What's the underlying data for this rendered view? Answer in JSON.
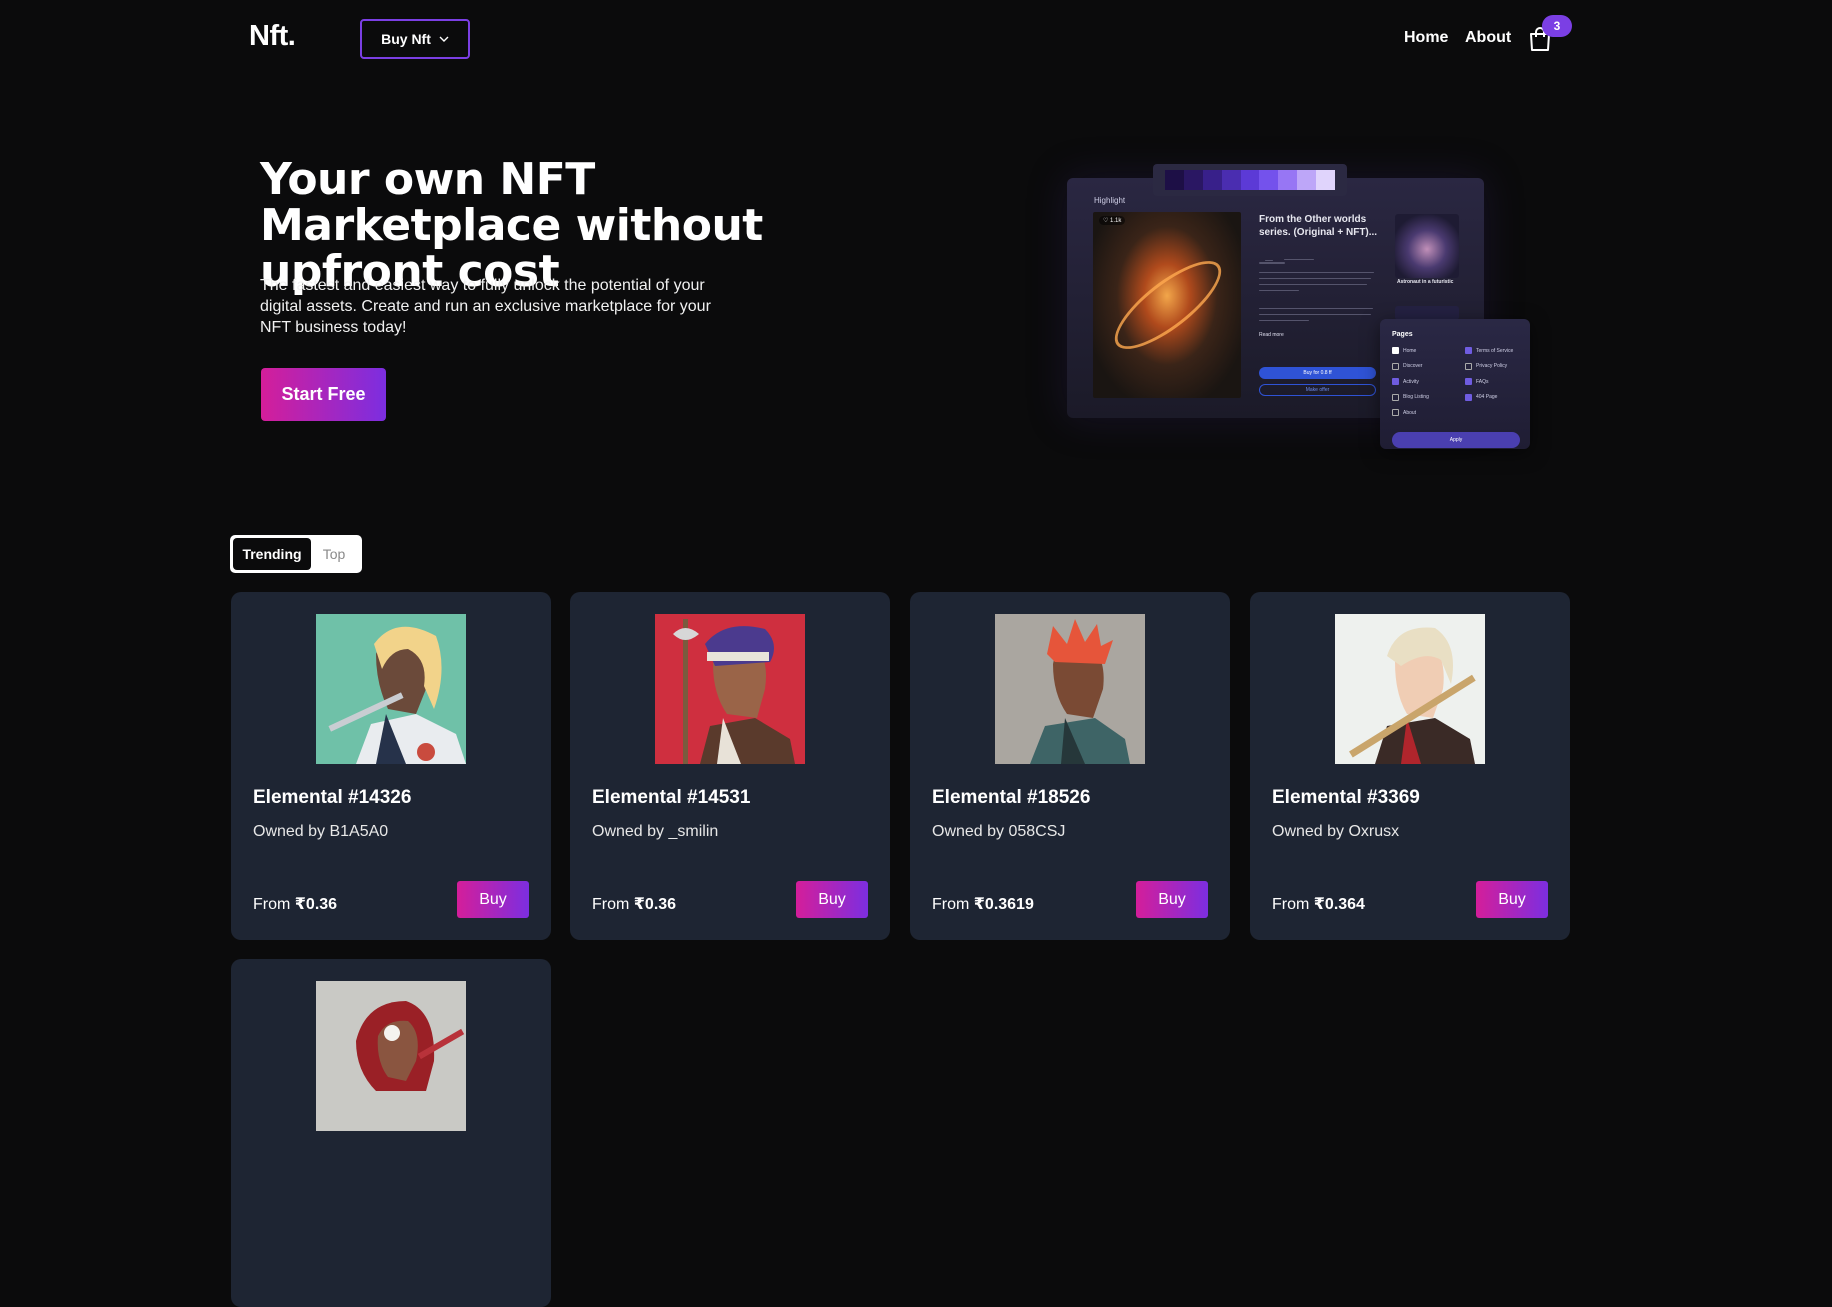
{
  "header": {
    "logo": "Nft.",
    "buy_nft_label": "Buy Nft",
    "nav": {
      "home": "Home",
      "about": "About"
    },
    "cart_count": "3",
    "accent": "#7b3fe4"
  },
  "hero": {
    "title": "Your own NFT Marketplace without upfront cost",
    "subtitle": "The fastest and easiest way to fully unlock the potential of your digital assets. Create and run an exclusive marketplace for your NFT business today!",
    "cta_label": "Start Free",
    "gradient": [
      "#d41e9a",
      "#7c2ee0"
    ]
  },
  "preview": {
    "palette": [
      "#1d0f46",
      "#2a1763",
      "#38208a",
      "#4a2db0",
      "#5c3ad6",
      "#7452ec",
      "#9776f4",
      "#bda6f8",
      "#e0d4fc"
    ],
    "highlight_label": "Highlight",
    "likes": "♡ 1.1k",
    "art_title": "From the Other worlds series. (Original + NFT)...",
    "read_more": "Read more",
    "buy_label": "Buy for 0.8 ff",
    "offer_label": "Make offer",
    "thumb_title": "Astronaut in a futuristic",
    "pages_title": "Pages",
    "pages_left": [
      {
        "label": "Home",
        "checked": "white"
      },
      {
        "label": "Discover",
        "checked": ""
      },
      {
        "label": "Activity",
        "checked": "on"
      },
      {
        "label": "Blog Listing",
        "checked": ""
      },
      {
        "label": "About",
        "checked": ""
      }
    ],
    "pages_right": [
      {
        "label": "Terms of Service",
        "checked": "on"
      },
      {
        "label": "Privacy Policy",
        "checked": ""
      },
      {
        "label": "FAQs",
        "checked": "on"
      },
      {
        "label": "404 Page",
        "checked": "on"
      }
    ],
    "apply_label": "Apply"
  },
  "tabs": {
    "trending": "Trending",
    "top": "Top"
  },
  "cards": [
    {
      "name": "Elemental #14326",
      "owner": "Owned by B1A5A0",
      "price_prefix": "From ",
      "price": "₹0.36",
      "buy_label": "Buy"
    },
    {
      "name": "Elemental #14531",
      "owner": "Owned by _smilin",
      "price_prefix": "From ",
      "price": "₹0.36",
      "buy_label": "Buy"
    },
    {
      "name": "Elemental #18526",
      "owner": "Owned by 058CSJ",
      "price_prefix": "From ",
      "price": "₹0.3619",
      "buy_label": "Buy"
    },
    {
      "name": "Elemental #3369",
      "owner": "Owned by Oxrusx",
      "price_prefix": "From ",
      "price": "₹0.364",
      "buy_label": "Buy"
    }
  ]
}
